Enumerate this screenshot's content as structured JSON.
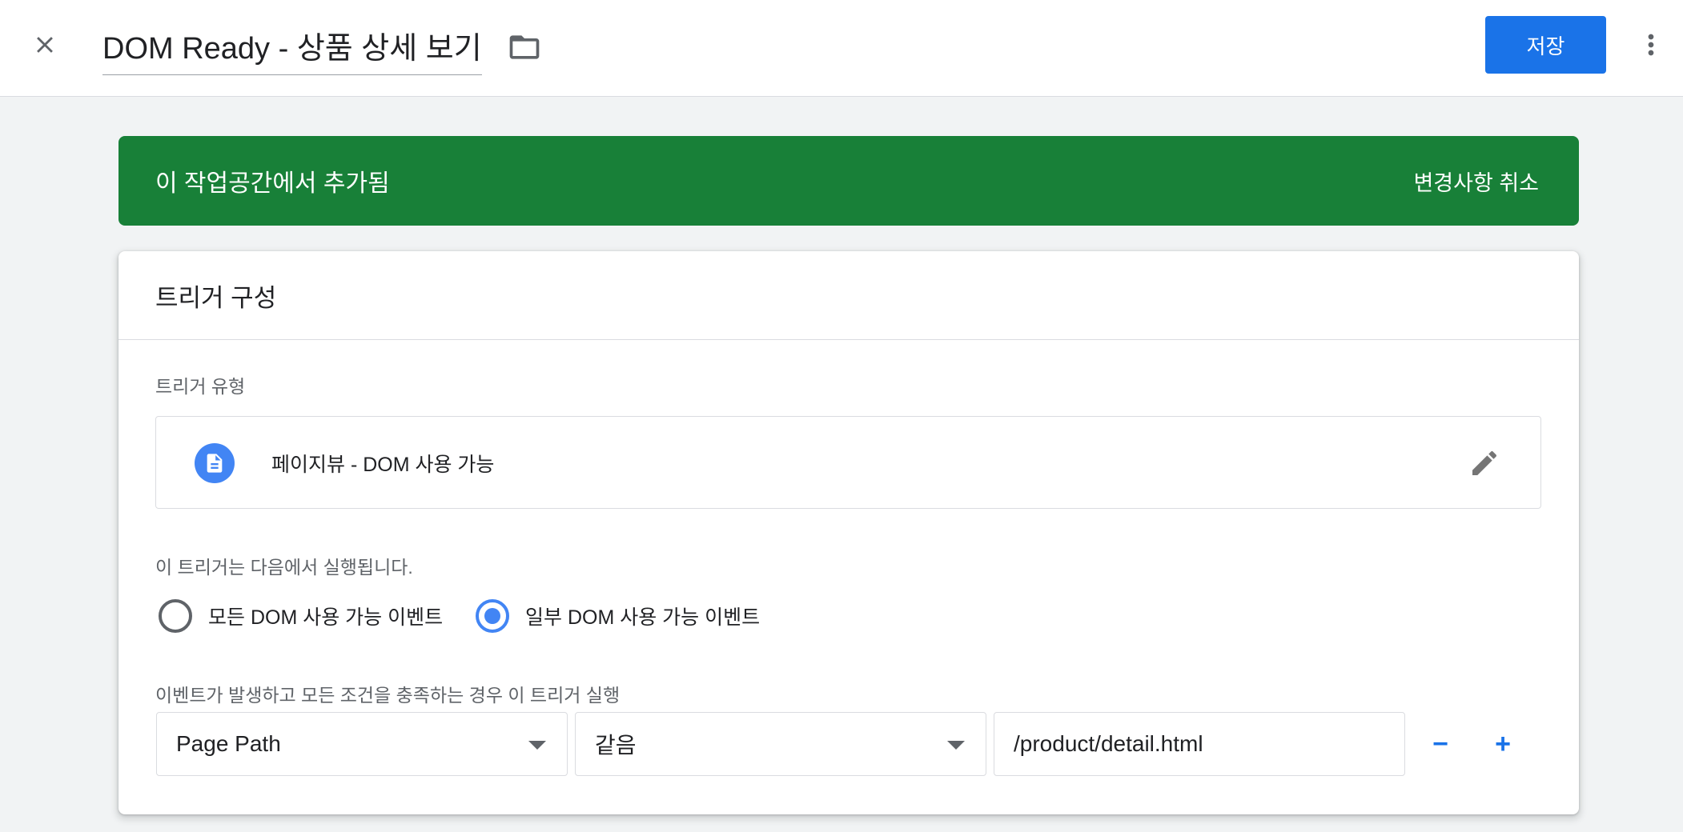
{
  "header": {
    "title": "DOM Ready - 상품 상세 보기",
    "save_label": "저장",
    "close_icon": "close-icon",
    "folder_icon": "folder-icon",
    "more_icon": "more-vert-icon"
  },
  "banner": {
    "message": "이 작업공간에서 추가됨",
    "action_label": "변경사항 취소",
    "color": "#188038"
  },
  "card": {
    "title": "트리거 구성",
    "trigger_type_label": "트리거 유형",
    "trigger_type": {
      "name": "페이지뷰 - DOM 사용 가능",
      "icon": "document-icon",
      "edit_icon": "edit-icon"
    },
    "fires_on_label": "이 트리거는 다음에서 실행됩니다.",
    "fires_on_options": [
      {
        "label": "모든 DOM 사용 가능 이벤트",
        "selected": false
      },
      {
        "label": "일부 DOM 사용 가능 이벤트",
        "selected": true
      }
    ],
    "condition_label": "이벤트가 발생하고 모든 조건을 충족하는 경우 이 트리거 실행",
    "condition": {
      "variable": "Page Path",
      "operator": "같음",
      "value": "/product/detail.html"
    },
    "remove_label": "−",
    "add_label": "+"
  },
  "colors": {
    "accent": "#1a73e8",
    "radio_selected": "#4285f4",
    "background": "#f1f3f4"
  }
}
